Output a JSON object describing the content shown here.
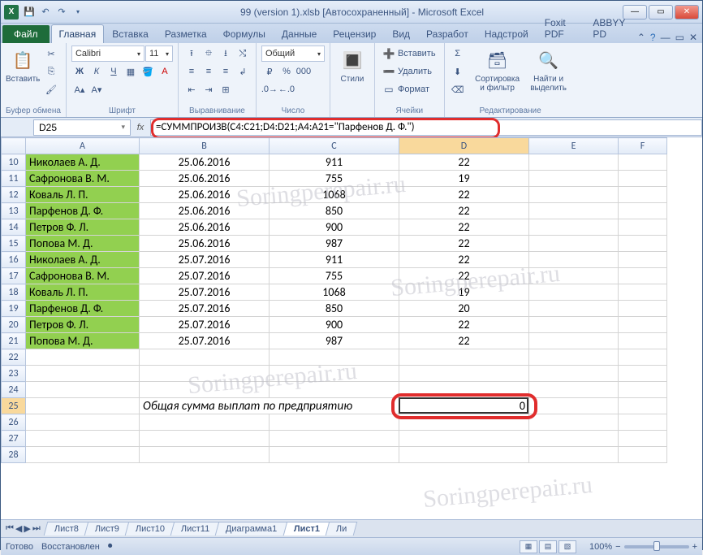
{
  "window": {
    "title": "99 (version 1).xlsb [Автосохраненный] - Microsoft Excel"
  },
  "qat": {
    "save_tip": "save",
    "undo_tip": "undo",
    "redo_tip": "redo"
  },
  "tabs": {
    "file": "Файл",
    "items": [
      "Главная",
      "Вставка",
      "Разметка",
      "Формулы",
      "Данные",
      "Рецензир",
      "Вид",
      "Разработ",
      "Надстрой",
      "Foxit PDF",
      "ABBYY PD"
    ],
    "active_index": 0
  },
  "ribbon": {
    "clipboard": {
      "label": "Буфер обмена",
      "paste": "Вставить"
    },
    "font": {
      "label": "Шрифт",
      "name": "Calibri",
      "size": "11",
      "bold": "Ж",
      "italic": "К",
      "underline": "Ч"
    },
    "alignment": {
      "label": "Выравнивание"
    },
    "number": {
      "label": "Число",
      "format": "Общий"
    },
    "styles": {
      "label": "",
      "btn": "Стили"
    },
    "cells": {
      "label": "Ячейки",
      "insert": "Вставить",
      "delete": "Удалить",
      "format": "Формат"
    },
    "editing": {
      "label": "Редактирование",
      "sort": "Сортировка и фильтр",
      "find": "Найти и выделить"
    }
  },
  "namebox": "D25",
  "formula": "=СУММПРОИЗВ(C4:C21;D4:D21;A4:A21=\"Парфенов Д. Ф.\")",
  "columns": [
    "",
    "A",
    "B",
    "C",
    "D",
    "E",
    "F"
  ],
  "chart_data": {
    "type": "table",
    "columns": [
      "row",
      "A_name",
      "B_date",
      "C_value",
      "D_value"
    ],
    "rows": [
      {
        "row": 10,
        "A_name": "Николаев А. Д.",
        "B_date": "25.06.2016",
        "C_value": 911,
        "D_value": 22
      },
      {
        "row": 11,
        "A_name": "Сафронова В. М.",
        "B_date": "25.06.2016",
        "C_value": 755,
        "D_value": 19
      },
      {
        "row": 12,
        "A_name": "Коваль Л. П.",
        "B_date": "25.06.2016",
        "C_value": 1068,
        "D_value": 22
      },
      {
        "row": 13,
        "A_name": "Парфенов Д. Ф.",
        "B_date": "25.06.2016",
        "C_value": 850,
        "D_value": 22
      },
      {
        "row": 14,
        "A_name": "Петров Ф. Л.",
        "B_date": "25.06.2016",
        "C_value": 900,
        "D_value": 22
      },
      {
        "row": 15,
        "A_name": "Попова М. Д.",
        "B_date": "25.06.2016",
        "C_value": 987,
        "D_value": 22
      },
      {
        "row": 16,
        "A_name": "Николаев А. Д.",
        "B_date": "25.07.2016",
        "C_value": 911,
        "D_value": 22
      },
      {
        "row": 17,
        "A_name": "Сафронова В. М.",
        "B_date": "25.07.2016",
        "C_value": 755,
        "D_value": 22
      },
      {
        "row": 18,
        "A_name": "Коваль Л. П.",
        "B_date": "25.07.2016",
        "C_value": 1068,
        "D_value": 19
      },
      {
        "row": 19,
        "A_name": "Парфенов Д. Ф.",
        "B_date": "25.07.2016",
        "C_value": 850,
        "D_value": 20
      },
      {
        "row": 20,
        "A_name": "Петров Ф. Л.",
        "B_date": "25.07.2016",
        "C_value": 900,
        "D_value": 22
      },
      {
        "row": 21,
        "A_name": "Попова М. Д.",
        "B_date": "25.07.2016",
        "C_value": 987,
        "D_value": 22
      }
    ],
    "summary_row": {
      "row": 25,
      "label": "Общая сумма выплат по предприятию",
      "D": 0
    }
  },
  "sheet_tabs": [
    "Лист8",
    "Лист9",
    "Лист10",
    "Лист11",
    "Диаграмма1",
    "Лист1",
    "Ли"
  ],
  "active_sheet_index": 5,
  "status": {
    "ready": "Готово",
    "recovered": "Восстановлен",
    "zoom": "100%"
  }
}
